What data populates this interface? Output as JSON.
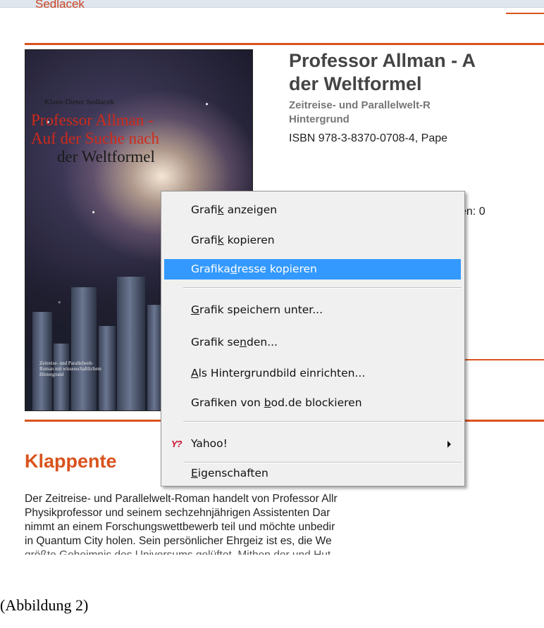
{
  "page": {
    "author_link": "Sedlacek",
    "cover": {
      "author": "Klaus-Dieter Sedlacek",
      "title_line1": "Professor Allman -",
      "title_line2": "Auf der Suche nach",
      "title_line3": "der Weltformel",
      "small_text": "Zeitreise- und Parallelwelt-Roman mit wissenschaftlichem Hintergrund"
    },
    "title_line1": "Professor Allman - A",
    "title_line2": "der Weltformel",
    "subtitle_line1": "Zeitreise- und Parallelwelt-R",
    "subtitle_line2": "Hintergrund",
    "isbn": "ISBN 978-3-8370-0708-4, Pape",
    "count": "en: 0",
    "section_heading": "Klappente",
    "body_lines": [
      "Der Zeitreise- und Parallelwelt-Roman handelt von Professor Allr",
      "Physikprofessor und seinem sechzehnjährigen Assistenten Dar",
      "nimmt an einem Forschungswettbewerb teil und möchte unbedir",
      "in Quantum City holen. Sein persönlicher Ehrgeiz ist es, die We",
      "größte Geheimnis des Universums gelüftet. Mithen der und Hut"
    ]
  },
  "context_menu": {
    "items": [
      {
        "pre": "Grafi",
        "u": "k",
        "post": " anzeigen"
      },
      {
        "pre": "Grafi",
        "u": "k",
        "post": " kopieren"
      },
      {
        "pre": "Grafika",
        "u": "d",
        "post": "resse kopieren"
      },
      {
        "pre": "",
        "u": "G",
        "post": "rafik speichern unter..."
      },
      {
        "pre": "Grafik se",
        "u": "n",
        "post": "den..."
      },
      {
        "pre": "",
        "u": "A",
        "post": "ls Hintergrundbild einrichten..."
      },
      {
        "pre": "Grafiken von ",
        "u": "b",
        "post": "od.de blockieren"
      },
      {
        "pre": "",
        "u": "",
        "post": "Yahoo!"
      },
      {
        "pre": "",
        "u": "E",
        "post": "igenschaften"
      }
    ],
    "highlighted_index": 2,
    "yahoo_icon_text": "Y?"
  },
  "caption": "(Abbildung 2)"
}
